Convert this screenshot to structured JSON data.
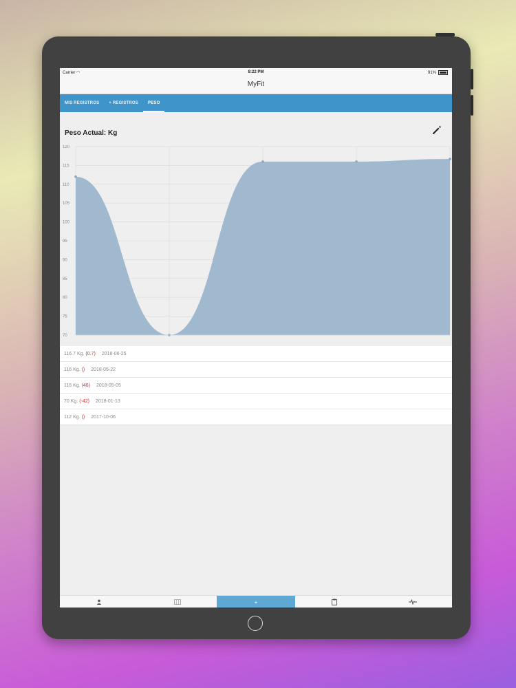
{
  "status_bar": {
    "carrier": "Carrier",
    "time": "8:22 PM",
    "battery": "91%"
  },
  "nav": {
    "title": "MyFit"
  },
  "tabs": [
    {
      "label": "MIS REGISTROS"
    },
    {
      "label": "+ REGISTROS"
    },
    {
      "label": "PESO"
    }
  ],
  "active_tab": "PESO",
  "section": {
    "title": "Peso Actual:  Kg"
  },
  "chart_data": {
    "type": "area",
    "x": [
      "2017-10-06",
      "2018-01-13",
      "2018-05-05",
      "2018-05-22",
      "2018-06-25"
    ],
    "series": [
      {
        "values": [
          112,
          70,
          116,
          116,
          116.7
        ]
      }
    ],
    "yticks": [
      120,
      115,
      110,
      105,
      100,
      95,
      90,
      85,
      80,
      75,
      70
    ],
    "ylim": [
      70,
      120
    ],
    "grid": true,
    "fill_color": "#a0b9cf",
    "point_color": "#8aa8c4"
  },
  "records": [
    {
      "weight": "116.7 Kg.",
      "delta": "(0.7)",
      "date": "2018-06-25"
    },
    {
      "weight": "116 Kg.",
      "delta": "()",
      "date": "2018-05-22"
    },
    {
      "weight": "116 Kg.",
      "delta": "(46)",
      "date": "2018-05-05"
    },
    {
      "weight": "70 Kg.",
      "delta": "(-42)",
      "date": "2018-01-13"
    },
    {
      "weight": "112 Kg.",
      "delta": "()",
      "date": "2017-10-06"
    }
  ],
  "tab_bar": {
    "items": [
      {
        "icon": "person-icon"
      },
      {
        "icon": "list-icon"
      },
      {
        "icon": "plus-icon",
        "glyph": "+"
      },
      {
        "icon": "clipboard-icon"
      },
      {
        "icon": "pulse-icon"
      }
    ],
    "active_index": 2
  },
  "colors": {
    "tab_bar_blue": "#3f94c9",
    "delta_red": "#cc3333"
  }
}
